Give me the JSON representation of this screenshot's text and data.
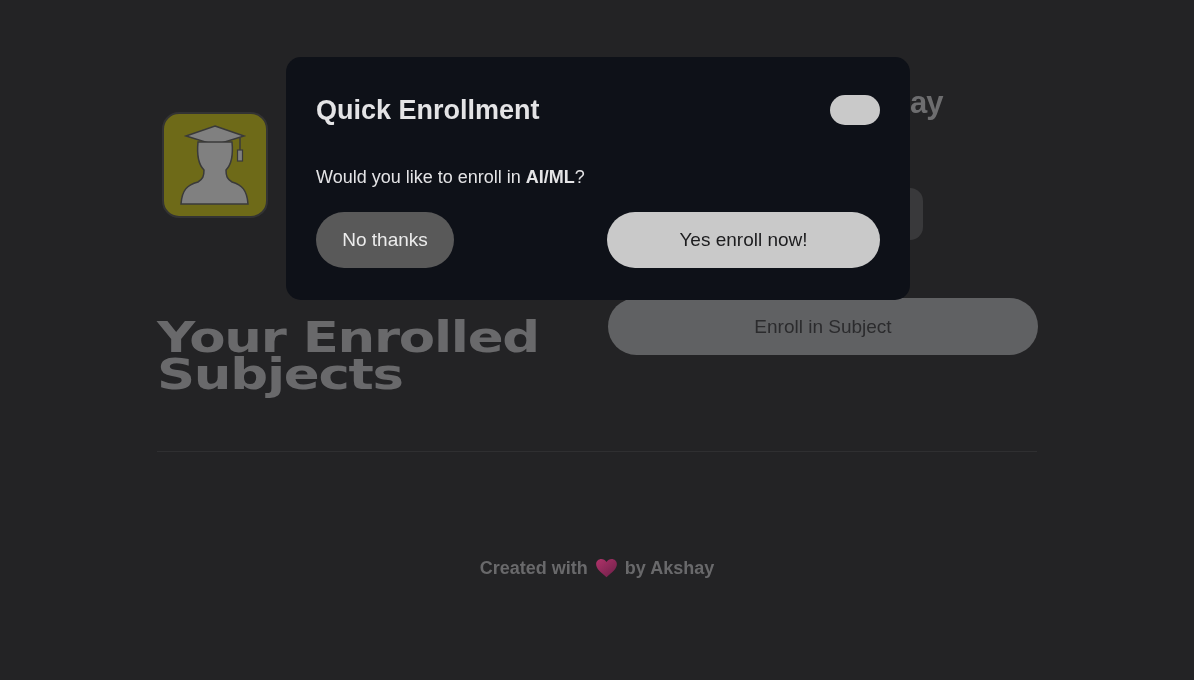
{
  "dialog": {
    "title": "Quick Enrollment",
    "message": "Would you like to enroll in **AI/ML**?",
    "buttons": [
      {
        "label": "No thanks",
        "kind": "secondary"
      },
      {
        "label": "Yes enroll now!",
        "kind": "primary"
      }
    ]
  },
  "profile": {
    "heading_fragment": "ay"
  },
  "enroll_button": {
    "label": "Enroll in Subject"
  },
  "section": {
    "title": "Your Enrolled Subjects"
  },
  "footer": {
    "text_before": "Created with",
    "text_after": "by Akshay"
  }
}
